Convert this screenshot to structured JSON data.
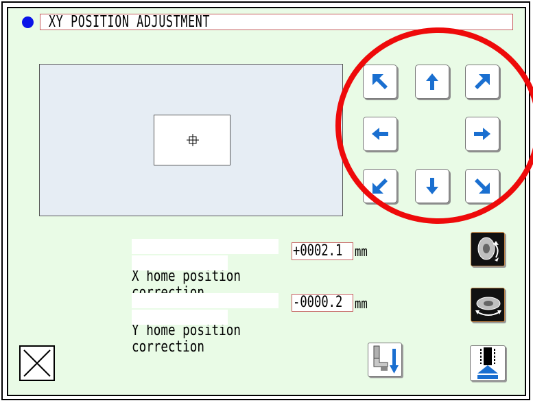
{
  "window": {
    "title": "XY POSITION ADJUSTMENT"
  },
  "colors": {
    "background": "#e9fbe6",
    "accent_blue": "#1a6fd0",
    "title_dot": "#0a14e8",
    "highlight_circle": "#ee0a0a",
    "value_border": "#c45a5a"
  },
  "jog_pad": {
    "buttons": [
      {
        "name": "up-left",
        "icon": "arrow-up-left-icon"
      },
      {
        "name": "up",
        "icon": "arrow-up-icon"
      },
      {
        "name": "up-right",
        "icon": "arrow-up-right-icon"
      },
      {
        "name": "left",
        "icon": "arrow-left-icon"
      },
      {
        "name": "right",
        "icon": "arrow-right-icon"
      },
      {
        "name": "down-left",
        "icon": "arrow-down-left-icon"
      },
      {
        "name": "down",
        "icon": "arrow-down-icon"
      },
      {
        "name": "down-right",
        "icon": "arrow-down-right-icon"
      }
    ]
  },
  "x_correction": {
    "label_line1": "X home position",
    "label_line2": "correction",
    "value": "+0002.1",
    "unit": "mm",
    "button_icon": "dial-x-adjust-icon"
  },
  "y_correction": {
    "label_line1": "Y home position",
    "label_line2": "correction",
    "value": "-0000.2",
    "unit": "mm",
    "button_icon": "dial-y-adjust-icon"
  },
  "bottom_bar": {
    "cancel_icon": "close-x-icon",
    "presser_icon": "presser-foot-down-icon",
    "feed_icon": "feed-up-icon"
  }
}
